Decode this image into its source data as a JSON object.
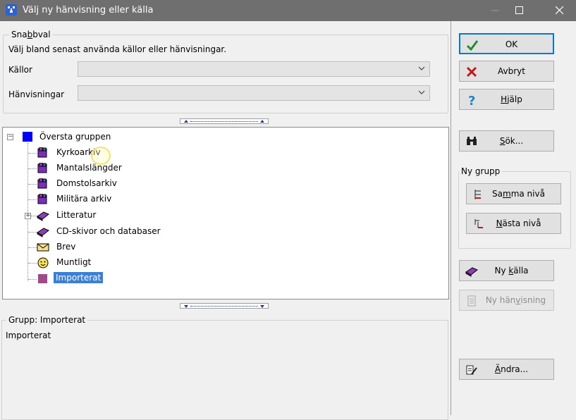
{
  "window": {
    "title": "Välj ny hänvisning eller källa"
  },
  "snabbval": {
    "legend_pre": "Sna",
    "legend_u": "b",
    "legend_post": "bval",
    "hint": "Välj bland senast använda källor eller hänvisningar.",
    "kallor_label": "Källor",
    "kallor_value": "",
    "hanvisningar_label": "Hänvisningar",
    "hanvisningar_value": ""
  },
  "tree": {
    "root": "Översta gruppen",
    "items": [
      "Kyrkoarkiv",
      "Mantalslängder",
      "Domstolsarkiv",
      "Militära arkiv",
      "Litteratur",
      "CD-skivor och databaser",
      "Brev",
      "Muntligt",
      "Importerat"
    ],
    "selected": "Importerat"
  },
  "details": {
    "legend": "Grupp: Importerat",
    "text": "Importerat"
  },
  "buttons": {
    "ok": "OK",
    "avbryt": "Avbryt",
    "hjalp_pre": "",
    "hjalp_u": "H",
    "hjalp_post": "jälp",
    "sok_pre": "",
    "sok_u": "S",
    "sok_post": "ök...",
    "ny_grupp_label": "Ny grupp",
    "samma_pre": "Sa",
    "samma_u": "m",
    "samma_post": "ma nivå",
    "nasta_pre": "",
    "nasta_u": "N",
    "nasta_post": "ästa nivå",
    "ny_kalla_pre": "Ny ",
    "ny_kalla_u": "k",
    "ny_kalla_post": "älla",
    "ny_hanv_pre": "Ny hän",
    "ny_hanv_u": "v",
    "ny_hanv_post": "isning",
    "andra_pre": "",
    "andra_u": "Ä",
    "andra_post": "ndra..."
  },
  "colors": {
    "titlebar": "#6f6f6f",
    "selection": "#3b7fd6",
    "accent": "#0078d7"
  }
}
